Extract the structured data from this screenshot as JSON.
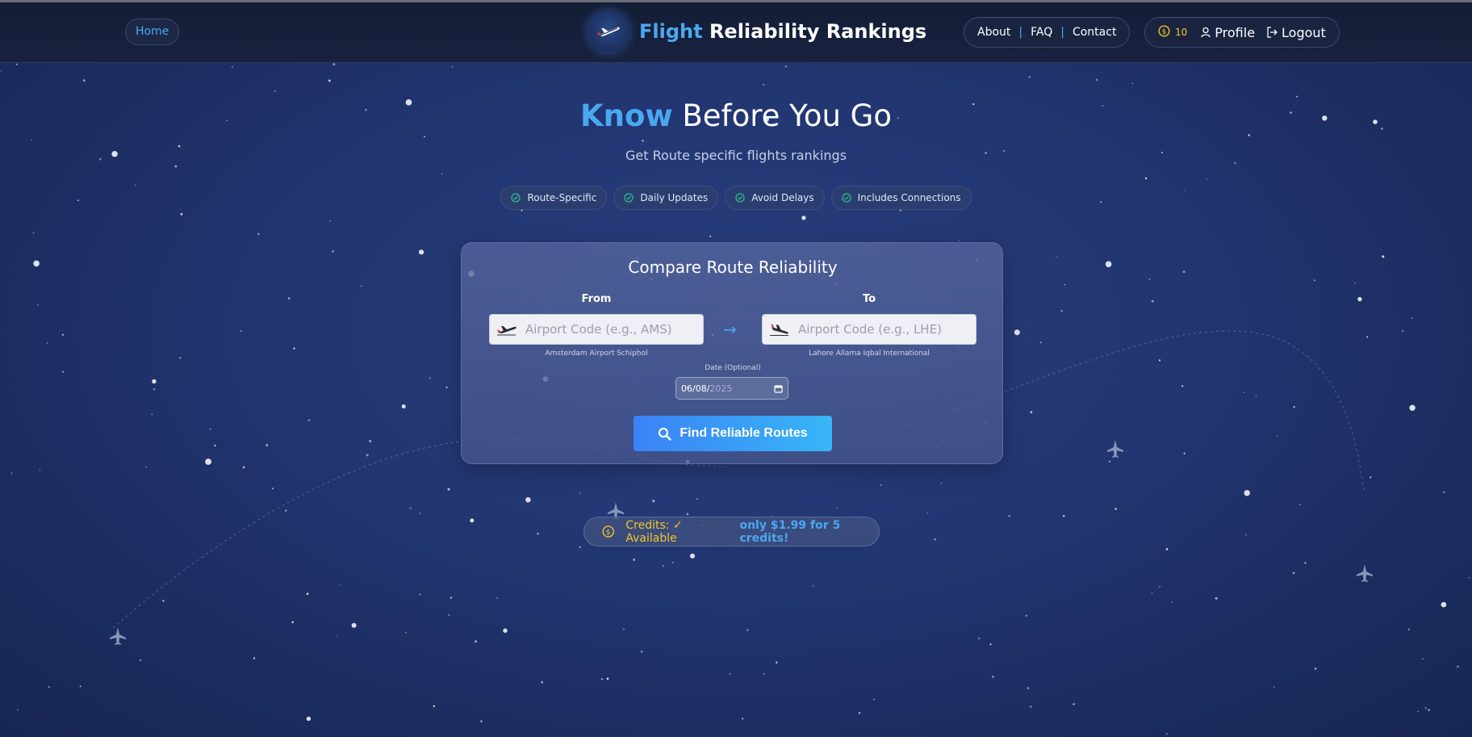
{
  "nav": {
    "home_label": "Home",
    "brand_title_accent": "Flight",
    "brand_title_rest": " Reliability Rankings",
    "links": [
      "About",
      "FAQ",
      "Contact"
    ],
    "credit_count": "10",
    "profile_label": "Profile",
    "logout_label": "Logout"
  },
  "hero": {
    "title_accent": "Know",
    "title_rest": " Before You Go",
    "subtitle": "Get Route specific flights rankings"
  },
  "features": [
    "Route-Specific",
    "Daily Updates",
    "Avoid Delays",
    "Includes Connections"
  ],
  "search": {
    "title": "Compare Route Reliability",
    "from_label": "From",
    "from_placeholder": "Airport Code (e.g., AMS)",
    "from_airport_name": "Amsterdam Airport Schiphol",
    "arrow": "→",
    "to_label": "To",
    "to_placeholder": "Airport Code (e.g., LHE)",
    "to_airport_name": "Lahore Allama Iqbal International",
    "date_label": "Date (Optional)",
    "date_day_month": "06/08/",
    "date_year": "2025",
    "submit_label": "Find Reliable Routes"
  },
  "credits_bar": {
    "label": "Credits: ✓ Available",
    "buy_text": "only $1.99 for 5 credits!"
  },
  "colors": {
    "accent": "#4aa8f0",
    "credit_gold": "#f3c623",
    "background": "#223672"
  }
}
